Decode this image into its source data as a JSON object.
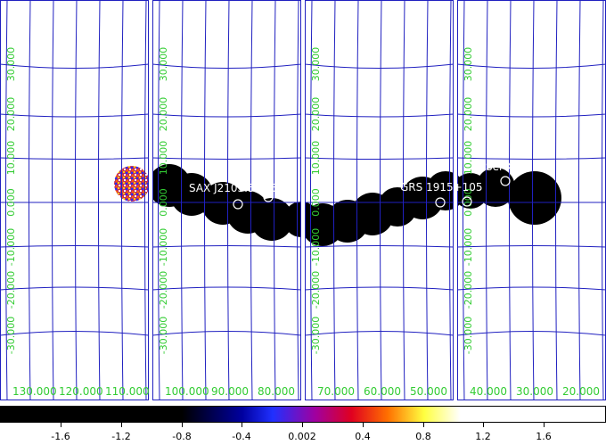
{
  "panels": [
    {
      "lon_labels": [
        "130.000",
        "120.000",
        "110.000"
      ]
    },
    {
      "lon_labels": [
        "100.000",
        "90.000",
        "80.000"
      ]
    },
    {
      "lon_labels": [
        "70.000",
        "60.000",
        "50.000"
      ]
    },
    {
      "lon_labels": [
        "40.000",
        "30.000",
        "20.000"
      ]
    }
  ],
  "lat_labels": [
    "30.000",
    "20.000",
    "10.000",
    "0.000",
    "-10.000",
    "-20.000",
    "-30.000"
  ],
  "sources": [
    {
      "label": "SAX J2103.5+4545"
    },
    {
      "label": "GRS 1915+105"
    },
    {
      "label": "Ser X-1"
    }
  ],
  "colorbar": {
    "ticks": [
      "-1.6",
      "-1.2",
      "-0.8",
      "-0.4",
      "0.002",
      "0.4",
      "0.8",
      "1.2",
      "1.6"
    ],
    "range": [
      -1.6,
      1.6
    ]
  },
  "colors": {
    "grid": "#2020c0",
    "label": "#33cc33",
    "background": "#ffffff",
    "exposure": "#000000",
    "source_text": "#ffffff"
  }
}
